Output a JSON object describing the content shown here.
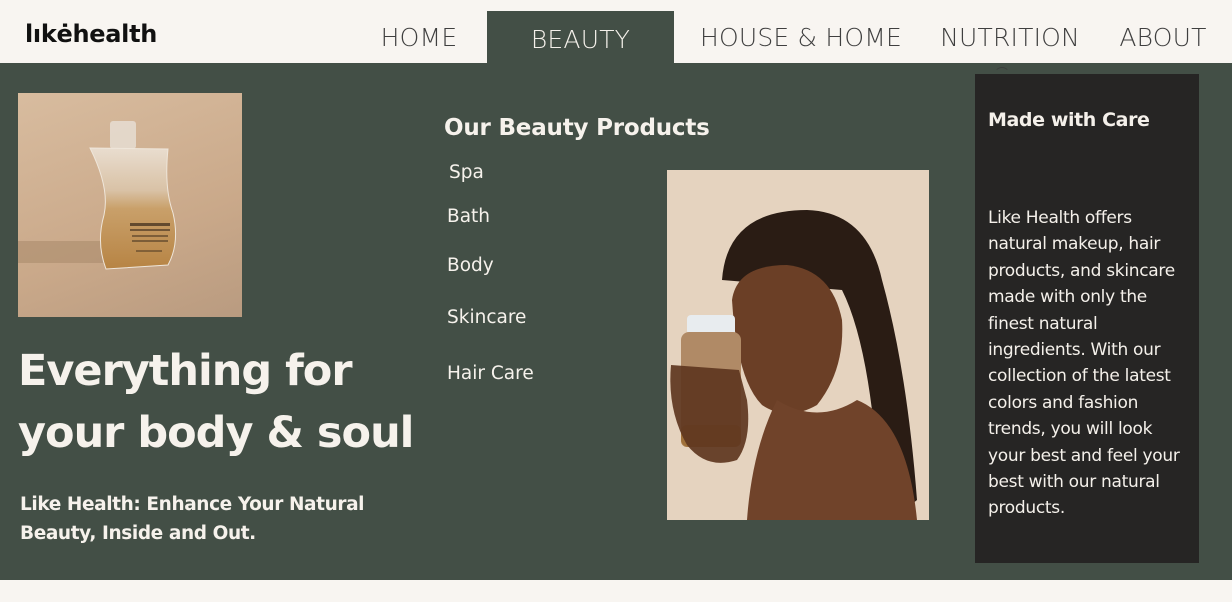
{
  "header": {
    "logo": "lıkėhealth",
    "nav": [
      {
        "label": "HOME",
        "active": false
      },
      {
        "label": "BEAUTY",
        "active": true
      },
      {
        "label": "HOUSE & HOME",
        "active": false
      },
      {
        "label": "NUTRITION",
        "active": false
      },
      {
        "label": "ABOUT",
        "active": false
      }
    ]
  },
  "hero": {
    "bottle_image_alt": "shampoo-bottle-photo",
    "headline_line1": "Everything for",
    "headline_line2": "your body & soul",
    "subhead_line1": "Like Health: Enhance Your Natural",
    "subhead_line2": "Beauty, Inside and Out."
  },
  "products": {
    "title": "Our Beauty Products",
    "items": [
      "Spa",
      "Bath",
      "Body",
      "Skincare",
      "Hair Care"
    ],
    "model_image_alt": "model-holding-bottle-photo"
  },
  "care_card": {
    "title": "Made with Care",
    "body": "Like Health offers natural makeup, hair products, and skincare made with only the finest natural ingredients. With our collection of the latest colors and fashion trends, you will look your best and feel your best with our natural products."
  },
  "colors": {
    "panel": "#434f46",
    "card": "#262524",
    "background": "#f8f5f1",
    "text_light": "#f6f2ec"
  }
}
